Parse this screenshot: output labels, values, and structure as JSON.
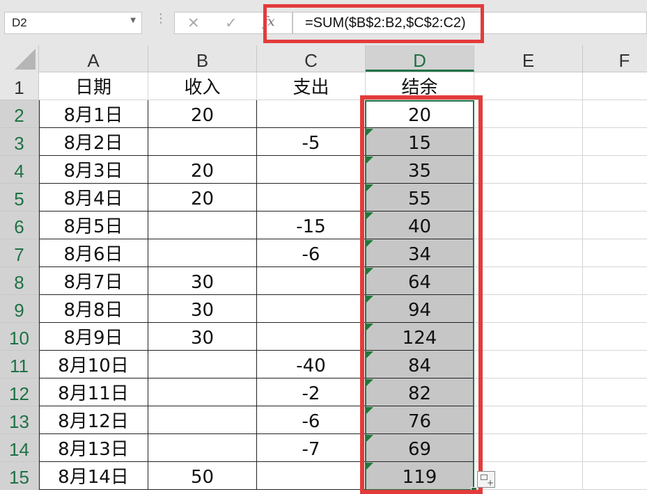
{
  "name_box": {
    "value": "D2"
  },
  "formula_bar": {
    "cancel_glyph": "✕",
    "enter_glyph": "✓",
    "fx_label": "fx",
    "formula": "=SUM($B$2:B2,$C$2:C2)"
  },
  "columns": [
    "A",
    "B",
    "C",
    "D",
    "E",
    "F"
  ],
  "selected_column": "D",
  "rows": [
    {
      "num": "1",
      "a": "日期",
      "b": "收入",
      "c": "支出",
      "d": "结余"
    },
    {
      "num": "2",
      "a": "8月1日",
      "b": "20",
      "c": "",
      "d": "20"
    },
    {
      "num": "3",
      "a": "8月2日",
      "b": "",
      "c": "-5",
      "d": "15"
    },
    {
      "num": "4",
      "a": "8月3日",
      "b": "20",
      "c": "",
      "d": "35"
    },
    {
      "num": "5",
      "a": "8月4日",
      "b": "20",
      "c": "",
      "d": "55"
    },
    {
      "num": "6",
      "a": "8月5日",
      "b": "",
      "c": "-15",
      "d": "40"
    },
    {
      "num": "7",
      "a": "8月6日",
      "b": "",
      "c": "-6",
      "d": "34"
    },
    {
      "num": "8",
      "a": "8月7日",
      "b": "30",
      "c": "",
      "d": "64"
    },
    {
      "num": "9",
      "a": "8月8日",
      "b": "30",
      "c": "",
      "d": "94"
    },
    {
      "num": "10",
      "a": "8月9日",
      "b": "30",
      "c": "",
      "d": "124"
    },
    {
      "num": "11",
      "a": "8月10日",
      "b": "",
      "c": "-40",
      "d": "84"
    },
    {
      "num": "12",
      "a": "8月11日",
      "b": "",
      "c": "-2",
      "d": "82"
    },
    {
      "num": "13",
      "a": "8月12日",
      "b": "",
      "c": "-6",
      "d": "76"
    },
    {
      "num": "14",
      "a": "8月13日",
      "b": "",
      "c": "-7",
      "d": "69"
    },
    {
      "num": "15",
      "a": "8月14日",
      "b": "50",
      "c": "",
      "d": "119"
    }
  ],
  "colors": {
    "highlight_box": "#e33b3b",
    "selection_green": "#217346",
    "error_flag": "#1f7a3a",
    "selected_fill": "#c6c6c6"
  },
  "icons": {
    "name_box_dropdown": "chevron-down-icon",
    "quick_analysis": "quick-analysis-icon"
  }
}
